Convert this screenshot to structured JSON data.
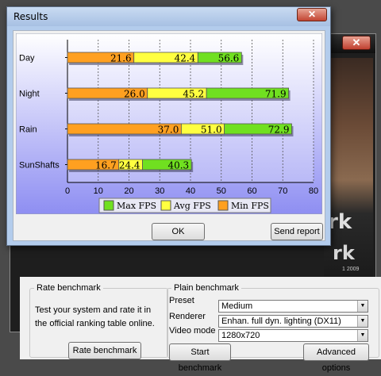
{
  "results_window": {
    "title": "Results",
    "ok_label": "OK",
    "send_report_label": "Send report"
  },
  "main_window": {
    "splash_text_1": "rk",
    "splash_text_2": "rk",
    "splash_copyright": "1 2009",
    "rate_benchmark": {
      "group_title": "Rate benchmark",
      "description": "Test your system and rate it in the official ranking table online.",
      "button_label": "Rate benchmark"
    },
    "plain_benchmark": {
      "group_title": "Plain benchmark",
      "preset_label": "Preset",
      "preset_value": "Medium",
      "renderer_label": "Renderer",
      "renderer_value": "Enhan. full dyn. lighting (DX11)",
      "video_mode_label": "Video mode",
      "video_mode_value": "1280x720",
      "start_button_label": "Start benchmark",
      "advanced_button_label": "Advanced options"
    }
  },
  "chart_data": {
    "type": "bar",
    "orientation": "horizontal",
    "stacked": true,
    "categories": [
      "Day",
      "Night",
      "Rain",
      "SunShafts"
    ],
    "series": [
      {
        "name": "Min FPS",
        "color": "#ffa020",
        "values": [
          21.6,
          26.0,
          37.0,
          16.7
        ]
      },
      {
        "name": "Avg FPS",
        "color": "#ffff40",
        "values": [
          42.4,
          45.2,
          51.0,
          24.4
        ]
      },
      {
        "name": "Max FPS",
        "color": "#70e020",
        "values": [
          56.6,
          71.9,
          72.9,
          40.3
        ]
      }
    ],
    "legend_order": [
      "Max FPS",
      "Avg FPS",
      "Min FPS"
    ],
    "xlim": [
      0,
      80
    ],
    "xticks": [
      0,
      10,
      20,
      30,
      40,
      50,
      60,
      70,
      80
    ],
    "grid": true,
    "legend_position": "bottom"
  }
}
